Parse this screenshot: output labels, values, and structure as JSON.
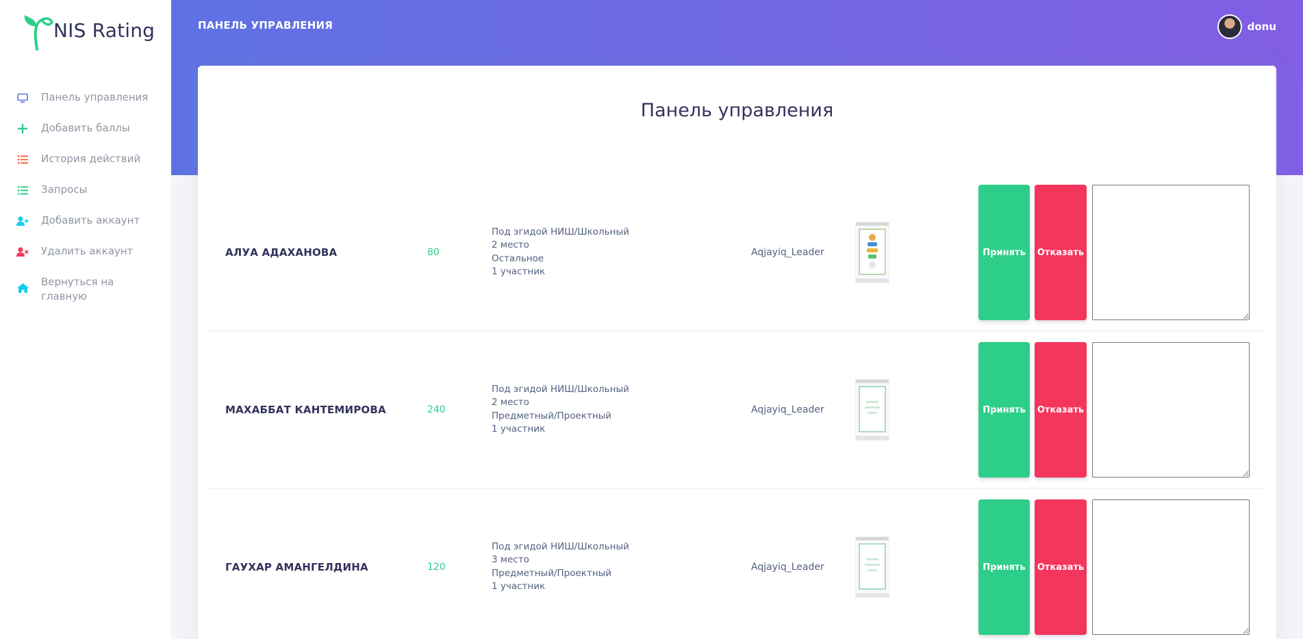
{
  "brand": {
    "name": "NIS Rating"
  },
  "sidebar": {
    "items": [
      {
        "label": "Панель управления",
        "icon": "monitor-icon",
        "color": "#5e72e4"
      },
      {
        "label": "Добавить баллы",
        "icon": "plus-icon",
        "color": "#2dce89"
      },
      {
        "label": "История действий",
        "icon": "list-icon",
        "color": "#fb6340"
      },
      {
        "label": "Запросы",
        "icon": "list-icon",
        "color": "#2dce89"
      },
      {
        "label": "Добавить аккаунт",
        "icon": "user-plus-icon",
        "color": "#11cdef"
      },
      {
        "label": "Удалить аккаунт",
        "icon": "user-times-icon",
        "color": "#f5365c"
      },
      {
        "label": "Вернуться на главную",
        "icon": "home-icon",
        "color": "#11cdef"
      }
    ]
  },
  "header": {
    "title": "ПАНЕЛЬ УПРАВЛЕНИЯ",
    "user": {
      "name": "donu"
    }
  },
  "main": {
    "title": "Панель управления",
    "accept_label": "Принять",
    "reject_label": "Отказать",
    "requests": [
      {
        "student": "АЛУА АДАХАНОВА",
        "points": "80",
        "details": [
          "Под эгидой НИШ/Школьный",
          "2 место",
          "Остальное",
          "1 участник"
        ],
        "author": "Aqjayiq_Leader"
      },
      {
        "student": "МАХАББАТ КАНТЕМИРОВА",
        "points": "240",
        "details": [
          "Под эгидой НИШ/Школьный",
          "2 место",
          "Предметный/Проектный",
          "1 участник"
        ],
        "author": "Aqjayiq_Leader"
      },
      {
        "student": "ГАУХАР АМАНГЕЛДИНА",
        "points": "120",
        "details": [
          "Под эгидой НИШ/Школьный",
          "3 место",
          "Предметный/Проектный",
          "1 участник"
        ],
        "author": "Aqjayiq_Leader"
      }
    ]
  },
  "colors": {
    "primary": "#5e72e4",
    "gradient_end": "#825ee4",
    "success": "#2dce89",
    "danger": "#f5365c"
  }
}
